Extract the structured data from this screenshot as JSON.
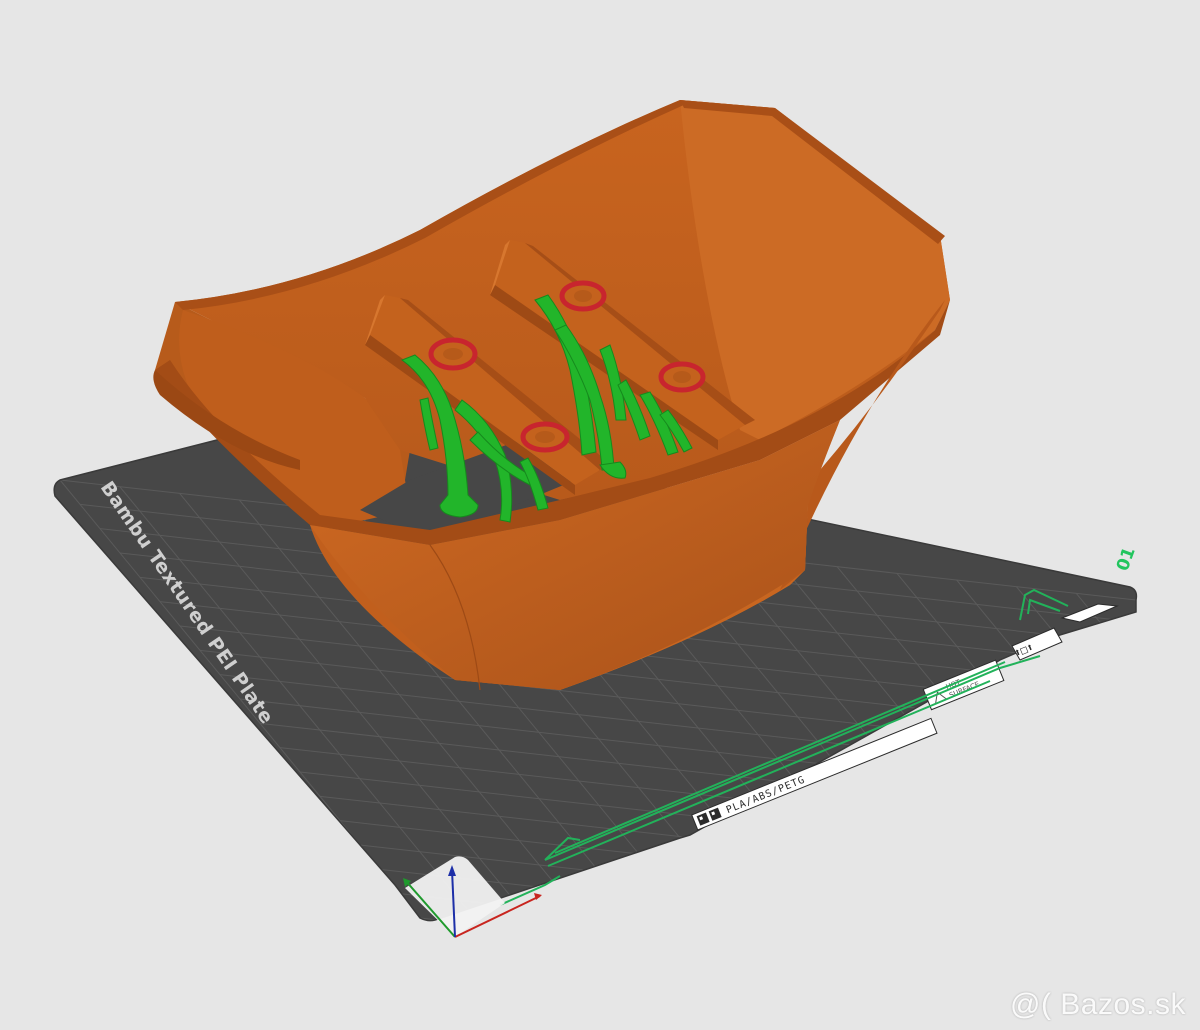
{
  "plate": {
    "brand_label": "Bambu Textured PEI Plate",
    "plate_number": "01",
    "material_label": "PLA/ABS/PETG",
    "hot_line1": "HOT",
    "hot_line2": "SURFACE"
  },
  "colors": {
    "background": "#e6e6e6",
    "plate": "#474747",
    "grid": "#5a5a5a",
    "model": "#c4621d",
    "support": "#22b52a",
    "accent_green": "#22c55e",
    "axis_x": "#c8251f",
    "axis_y": "#1f9a2d",
    "axis_z": "#1d2fa8"
  },
  "icons": {
    "axis_gizmo": "xyz-axes-icon",
    "hot_surface": "warning-triangle-icon"
  },
  "watermark": {
    "text": "@( Bazos.sk"
  }
}
